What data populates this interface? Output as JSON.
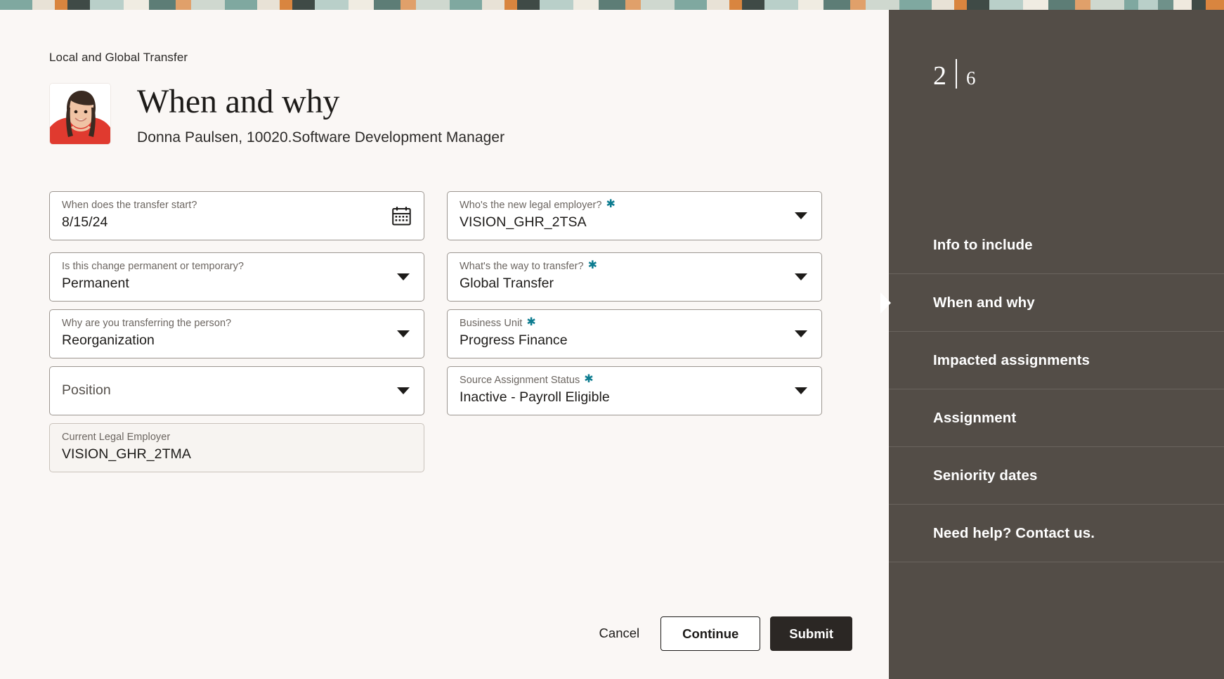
{
  "breadcrumb": "Local and Global Transfer",
  "header": {
    "title": "When and why",
    "subtitle": "Donna Paulsen, 10020.Software Development Manager",
    "avatar_alt": "employee-photo"
  },
  "colors": {
    "page_background": "#faf7f5",
    "sidebar_background": "#534d47",
    "required_asterisk": "#0d7c90",
    "submit_button": "#2b2724",
    "field_border": "#9c9690",
    "label_text": "#6b6560"
  },
  "form": {
    "rows": [
      {
        "left": {
          "label": "When does the transfer start?",
          "value": "8/15/24",
          "required": false,
          "control": "date",
          "icon": "calendar-icon",
          "readonly": false
        },
        "right": {
          "label": "Who's the new legal employer?",
          "value": "VISION_GHR_2TSA",
          "required": true,
          "control": "dropdown",
          "icon": "chevron-down-icon",
          "readonly": false
        }
      },
      {
        "left": {
          "label": "Is this change permanent or temporary?",
          "value": "Permanent",
          "required": false,
          "control": "dropdown",
          "icon": "chevron-down-icon",
          "readonly": false
        },
        "right": {
          "label": "What's the way to transfer?",
          "value": "Global Transfer",
          "required": true,
          "control": "dropdown",
          "icon": "chevron-down-icon",
          "readonly": false
        }
      },
      {
        "left": {
          "label": "Why are you transferring the person?",
          "value": "Reorganization",
          "required": false,
          "control": "dropdown",
          "icon": "chevron-down-icon",
          "readonly": false
        },
        "right": {
          "label": "Business Unit",
          "value": "Progress Finance",
          "required": true,
          "control": "dropdown",
          "icon": "chevron-down-icon",
          "readonly": false
        }
      },
      {
        "left": {
          "label": "Position",
          "value": "",
          "required": false,
          "control": "dropdown",
          "icon": "chevron-down-icon",
          "readonly": false,
          "empty": true
        },
        "right": {
          "label": "Source Assignment Status",
          "value": "Inactive - Payroll Eligible",
          "required": true,
          "control": "dropdown",
          "icon": "chevron-down-icon",
          "readonly": false
        }
      },
      {
        "left": {
          "label": "Current Legal Employer",
          "value": "VISION_GHR_2TMA",
          "required": false,
          "control": "text",
          "icon": "",
          "readonly": true
        },
        "right": null
      }
    ]
  },
  "footer": {
    "cancel_label": "Cancel",
    "continue_label": "Continue",
    "submit_label": "Submit"
  },
  "sidebar": {
    "step_current": "2",
    "step_total": "6",
    "items": [
      {
        "label": "Info to include",
        "active": false
      },
      {
        "label": "When and why",
        "active": true
      },
      {
        "label": "Impacted assignments",
        "active": false
      },
      {
        "label": "Assignment",
        "active": false
      },
      {
        "label": "Seniority dates",
        "active": false
      },
      {
        "label": "Need help? Contact us.",
        "active": false
      }
    ]
  }
}
